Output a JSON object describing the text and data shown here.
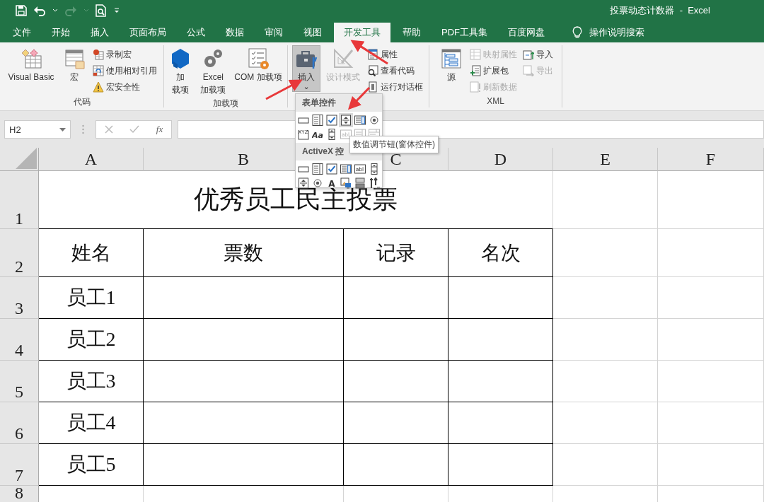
{
  "window": {
    "title": "投票动态计数器  -  Excel"
  },
  "tabs": [
    {
      "label": "文件",
      "selected": false
    },
    {
      "label": "开始",
      "selected": false
    },
    {
      "label": "插入",
      "selected": false
    },
    {
      "label": "页面布局",
      "selected": false
    },
    {
      "label": "公式",
      "selected": false
    },
    {
      "label": "数据",
      "selected": false
    },
    {
      "label": "审阅",
      "selected": false
    },
    {
      "label": "视图",
      "selected": false
    },
    {
      "label": "开发工具",
      "selected": true
    },
    {
      "label": "帮助",
      "selected": false
    },
    {
      "label": "PDF工具集",
      "selected": false
    },
    {
      "label": "百度网盘",
      "selected": false
    }
  ],
  "tell_me": {
    "placeholder": "操作说明搜索"
  },
  "ribbon": {
    "groups": [
      {
        "label": "代码",
        "items": [
          {
            "kind": "large",
            "label": "Visual Basic",
            "disabled": false,
            "pressed": false
          },
          {
            "kind": "large",
            "label": "宏",
            "disabled": false,
            "pressed": false
          },
          {
            "kind": "stack",
            "items": [
              {
                "label": "录制宏",
                "disabled": false
              },
              {
                "label": "使用相对引用",
                "disabled": false
              },
              {
                "label": "宏安全性",
                "disabled": false
              }
            ]
          }
        ]
      },
      {
        "label": "加载项",
        "items": [
          {
            "kind": "large",
            "label": [
              "加",
              "载项"
            ],
            "disabled": false,
            "pressed": false
          },
          {
            "kind": "large",
            "label": [
              "Excel",
              "加载项"
            ],
            "disabled": false,
            "pressed": false
          },
          {
            "kind": "large",
            "label": "COM 加载项",
            "disabled": false,
            "pressed": false
          }
        ]
      },
      {
        "items": [
          {
            "kind": "large",
            "label": "插入",
            "caret": "⌄",
            "disabled": false,
            "pressed": true
          },
          {
            "kind": "large",
            "label": "设计模式",
            "disabled": true,
            "pressed": false
          },
          {
            "kind": "stack",
            "items": [
              {
                "label": "属性",
                "disabled": false
              },
              {
                "label": "查看代码",
                "disabled": false
              },
              {
                "label": "运行对话框",
                "disabled": false
              }
            ]
          }
        ]
      },
      {
        "label": "XML",
        "items": [
          {
            "kind": "large",
            "label": "源",
            "disabled": false,
            "pressed": false
          },
          {
            "kind": "stack",
            "items": [
              {
                "label": "映射属性",
                "disabled": true
              },
              {
                "label": "扩展包",
                "disabled": false
              },
              {
                "label": "刷新数据",
                "disabled": true
              }
            ]
          },
          {
            "kind": "stack",
            "items": [
              {
                "label": "导入",
                "disabled": false
              },
              {
                "label": "导出",
                "disabled": true
              }
            ]
          }
        ]
      }
    ]
  },
  "formula_bar": {
    "name_box": "H2",
    "fx": "fx"
  },
  "sheet": {
    "columns": [
      "A",
      "B",
      "C",
      "D",
      "E",
      "F"
    ],
    "rows": [
      "1",
      "2",
      "3",
      "4",
      "5",
      "6",
      "7",
      "8"
    ],
    "title": "优秀员工民主投票",
    "headers": [
      "姓名",
      "票数",
      "记录",
      "名次"
    ],
    "names": [
      "员工1",
      "员工2",
      "员工3",
      "员工4",
      "员工5"
    ]
  },
  "insert_menu": {
    "sections": [
      {
        "heading": "表单控件",
        "controls": [
          {
            "kind": "button",
            "highlighted": false,
            "disabled": false
          },
          {
            "kind": "combo",
            "highlighted": false,
            "disabled": false
          },
          {
            "kind": "checkbox",
            "highlighted": false,
            "disabled": false
          },
          {
            "kind": "spinner",
            "highlighted": true,
            "disabled": false
          },
          {
            "kind": "listbox",
            "highlighted": false,
            "disabled": false
          },
          {
            "kind": "radio",
            "highlighted": false,
            "disabled": false
          },
          {
            "kind": "groupbox",
            "glyph": "XYZ",
            "highlighted": false,
            "disabled": false
          },
          {
            "kind": "label",
            "glyph": "Aa",
            "highlighted": false,
            "disabled": false
          },
          {
            "kind": "scrollbar",
            "highlighted": false,
            "disabled": false
          },
          {
            "kind": "textfield",
            "glyph": "abl",
            "highlighted": false,
            "disabled": true
          },
          {
            "kind": "combolist",
            "highlighted": false,
            "disabled": true
          },
          {
            "kind": "combodrop",
            "highlighted": false,
            "disabled": true
          }
        ]
      },
      {
        "heading": "ActiveX 控",
        "controls": [
          {
            "kind": "button",
            "highlighted": false,
            "disabled": false
          },
          {
            "kind": "combo",
            "highlighted": false,
            "disabled": false
          },
          {
            "kind": "checkbox",
            "highlighted": false,
            "disabled": false
          },
          {
            "kind": "listbox",
            "highlighted": false,
            "disabled": false
          },
          {
            "kind": "textfield",
            "glyph": "abl",
            "highlighted": false,
            "disabled": false
          },
          {
            "kind": "scrollbar",
            "highlighted": false,
            "disabled": false
          },
          {
            "kind": "spinner",
            "highlighted": false,
            "disabled": false
          },
          {
            "kind": "radio",
            "highlighted": false,
            "disabled": false
          },
          {
            "kind": "label",
            "glyph": "A",
            "highlighted": false,
            "disabled": false
          },
          {
            "kind": "image",
            "highlighted": false,
            "disabled": false
          },
          {
            "kind": "toggle",
            "highlighted": false,
            "disabled": false
          },
          {
            "kind": "more",
            "highlighted": false,
            "disabled": false
          }
        ]
      }
    ]
  },
  "tooltip": {
    "text": "数值调节钮(窗体控件)"
  }
}
